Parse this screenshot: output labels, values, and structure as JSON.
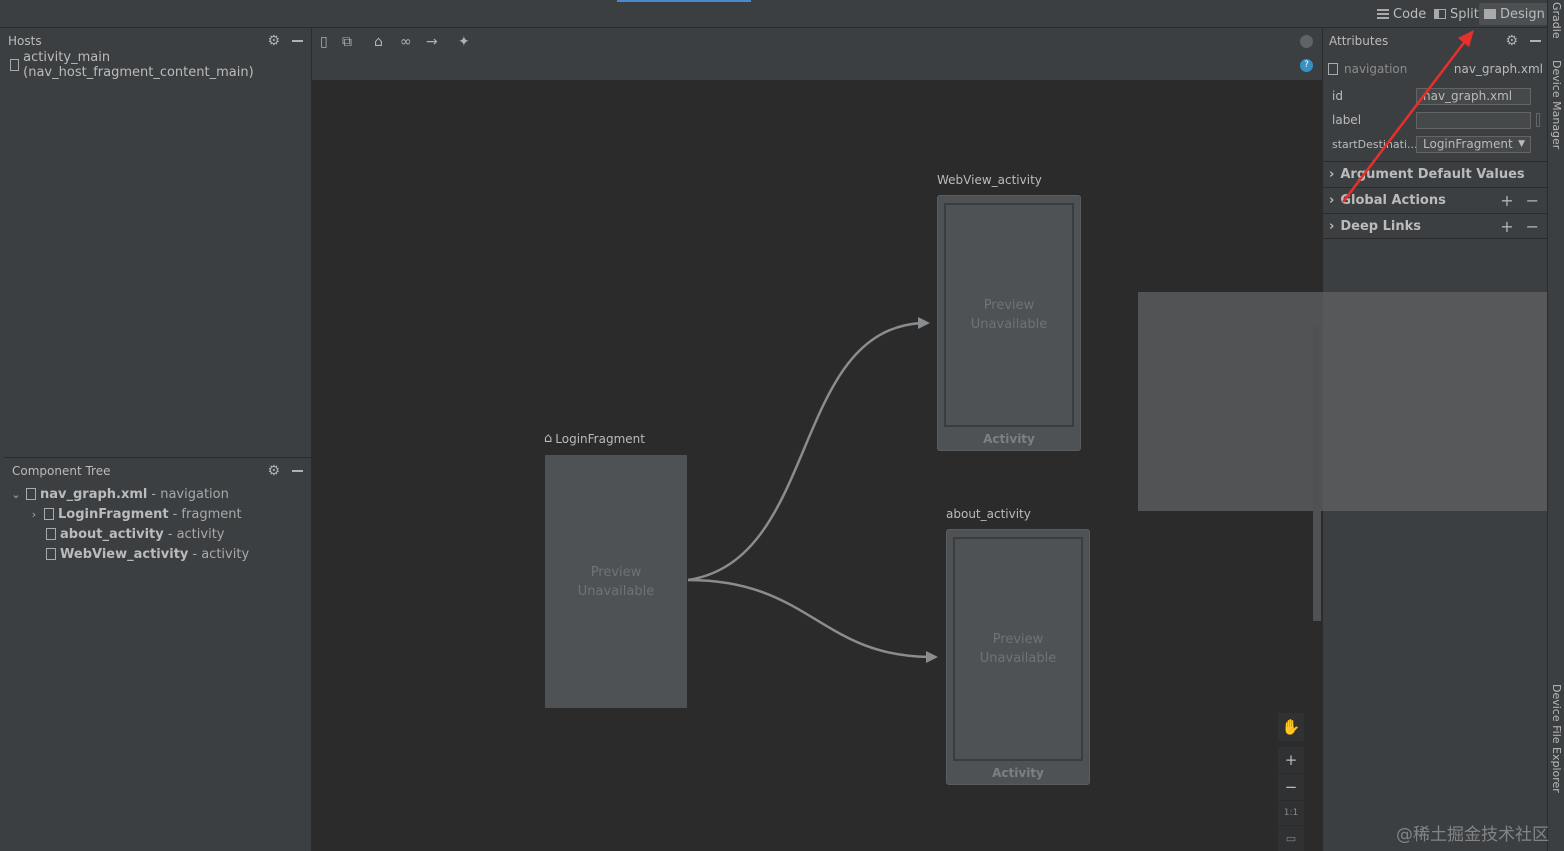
{
  "top_bar": {
    "modes": [
      {
        "label": "Code",
        "icon": "code-lines-icon"
      },
      {
        "label": "Split",
        "icon": "split-icon"
      },
      {
        "label": "Design",
        "icon": "design-image-icon",
        "active": true
      }
    ]
  },
  "hosts": {
    "title": "Hosts",
    "items": [
      {
        "label": "activity_main (nav_host_fragment_content_main)"
      }
    ]
  },
  "component_tree": {
    "title": "Component Tree",
    "rows": [
      {
        "name": "nav_graph.xml",
        "kind": "- navigation"
      },
      {
        "name": "LoginFragment",
        "kind": "- fragment"
      },
      {
        "name": "about_activity",
        "kind": "- activity"
      },
      {
        "name": "WebView_activity",
        "kind": "- activity"
      }
    ]
  },
  "graph": {
    "destinations": {
      "login": {
        "label": "LoginFragment",
        "preview": [
          "Preview",
          "Unavailable"
        ]
      },
      "webview": {
        "label": "WebView_activity",
        "preview": [
          "Preview",
          "Unavailable"
        ],
        "footer": "Activity"
      },
      "about": {
        "label": "about_activity",
        "preview": [
          "Preview",
          "Unavailable"
        ],
        "footer": "Activity"
      }
    }
  },
  "attributes": {
    "title": "Attributes",
    "type_label": "navigation",
    "file": "nav_graph.xml",
    "fields": [
      {
        "label": "id",
        "value": "nav_graph.xml"
      },
      {
        "label": "label",
        "value": ""
      },
      {
        "label": "startDestinati...",
        "value": "LoginFragment"
      }
    ],
    "sections": [
      {
        "label": "Argument Default Values"
      },
      {
        "label": "Global Actions"
      },
      {
        "label": "Deep Links"
      }
    ]
  },
  "side_tabs": {
    "gradle": "Gradle",
    "device_manager": "Device Manager",
    "device_file_explorer": "Device File Explorer"
  },
  "zoom": {
    "ratio_label": "1:1"
  },
  "watermark": "@稀土掘金技术社区",
  "colors": {
    "accent": "#4a88c7",
    "annotation_arrow": "#e8302a"
  }
}
